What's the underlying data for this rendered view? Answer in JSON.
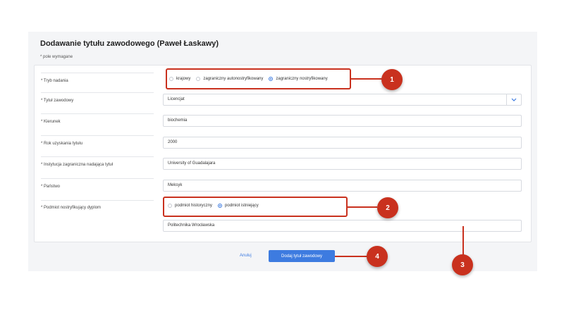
{
  "title": "Dodawanie tytułu zawodowego (Paweł Łaskawy)",
  "required_note": "* pole wymagane",
  "fields": {
    "tryb_nadania": {
      "label": "* Tryb nadania",
      "options": [
        "krajowy",
        "zagraniczny autonostryfikowany",
        "zagraniczny nostryfikowany"
      ],
      "selected": "zagraniczny nostryfikowany"
    },
    "tytul": {
      "label": "* Tytuł zawodowy",
      "value": "Licencjat"
    },
    "kierunek": {
      "label": "* Kierunek",
      "value": "biochemia"
    },
    "rok": {
      "label": "* Rok uzyskania tytułu",
      "value": "2000"
    },
    "instytucja": {
      "label": "* Instytucja zagraniczna nadająca tytuł",
      "value": "University of Guadalajara"
    },
    "panstwo": {
      "label": "* Państwo",
      "value": "Meksyk"
    },
    "podmiot": {
      "label": "* Podmiot nostryfikujący dyplom",
      "options": [
        "podmiot historyczny",
        "podmiot istniejący"
      ],
      "selected": "podmiot istniejący",
      "value": "Politechnika Wrocławska"
    }
  },
  "actions": {
    "cancel": "Anuluj",
    "submit": "Dodaj tytuł zawodowy"
  },
  "callouts": [
    "1",
    "2",
    "3",
    "4"
  ],
  "icons": {
    "dropdown": "chevron-down-icon"
  },
  "colors": {
    "accent": "#3d7be0",
    "callout": "#c9311e"
  }
}
